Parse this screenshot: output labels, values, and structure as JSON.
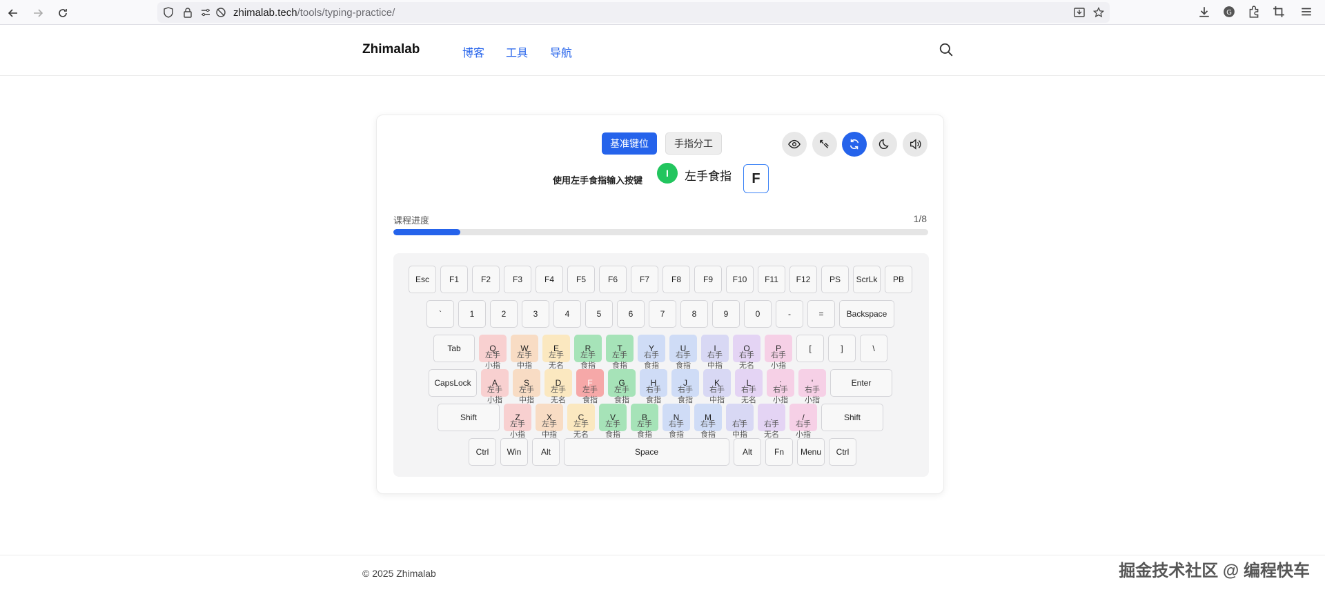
{
  "browser": {
    "url_host": "zhimalab.tech",
    "url_path": "/tools/typing-practice/"
  },
  "site": {
    "brand": "Zhimalab",
    "nav": [
      "博客",
      "工具",
      "导航"
    ]
  },
  "modes": {
    "active": "基准键位",
    "other": "手指分工"
  },
  "prompt": {
    "hint": "使用左手食指输入按键",
    "finger_badge": "I",
    "finger_name": "左手食指",
    "target_key": "F"
  },
  "progress": {
    "label": "课程进度",
    "count": "1/8",
    "value": 0.125
  },
  "keyboard": {
    "rows": [
      [
        "Esc",
        "F1",
        "F2",
        "F3",
        "F4",
        "F5",
        "F6",
        "F7",
        "F8",
        "F9",
        "F10",
        "F11",
        "F12",
        "PS",
        "ScrLk",
        "PB"
      ],
      [
        "`",
        "1",
        "2",
        "3",
        "4",
        "5",
        "6",
        "7",
        "8",
        "9",
        "0",
        "-",
        "=",
        "Backspace"
      ],
      [
        "Tab",
        "Q",
        "W",
        "E",
        "R",
        "T",
        "Y",
        "U",
        "I",
        "O",
        "P",
        "[",
        "]",
        "\\"
      ],
      [
        "CapsLock",
        "A",
        "S",
        "D",
        "F",
        "G",
        "H",
        "J",
        "K",
        "L",
        ";",
        "'",
        "Enter"
      ],
      [
        "Shift",
        "Z",
        "X",
        "C",
        "V",
        "B",
        "N",
        "M",
        ",",
        ".",
        "/",
        "Shift"
      ],
      [
        "Ctrl",
        "Win",
        "Alt",
        "Space",
        "Alt",
        "Fn",
        "Menu",
        "Ctrl"
      ]
    ],
    "finger_labels": {
      "lp": "左手\n小指",
      "lr": "左手\n无名\n指",
      "lm": "左手\n中指",
      "li": "左手\n食指",
      "ri": "右手\n食指",
      "rm": "右手\n中指",
      "rr": "右手\n无名\n指",
      "rp": "右手\n小指"
    },
    "finger_colors": {
      "lp": "#f8d0d0",
      "lr": "#fbe8c0",
      "lm": "#f8dcc4",
      "li": "#a6e3b8",
      "ri": "#cfdcf6",
      "rm": "#d8d8f4",
      "rr": "#e4d4f4",
      "rp": "#f6d0e6",
      "target": "#f6a8a8"
    }
  },
  "footer": {
    "copyright": "© 2025 Zhimalab",
    "watermark": "掘金技术社区 @ 编程快车"
  }
}
